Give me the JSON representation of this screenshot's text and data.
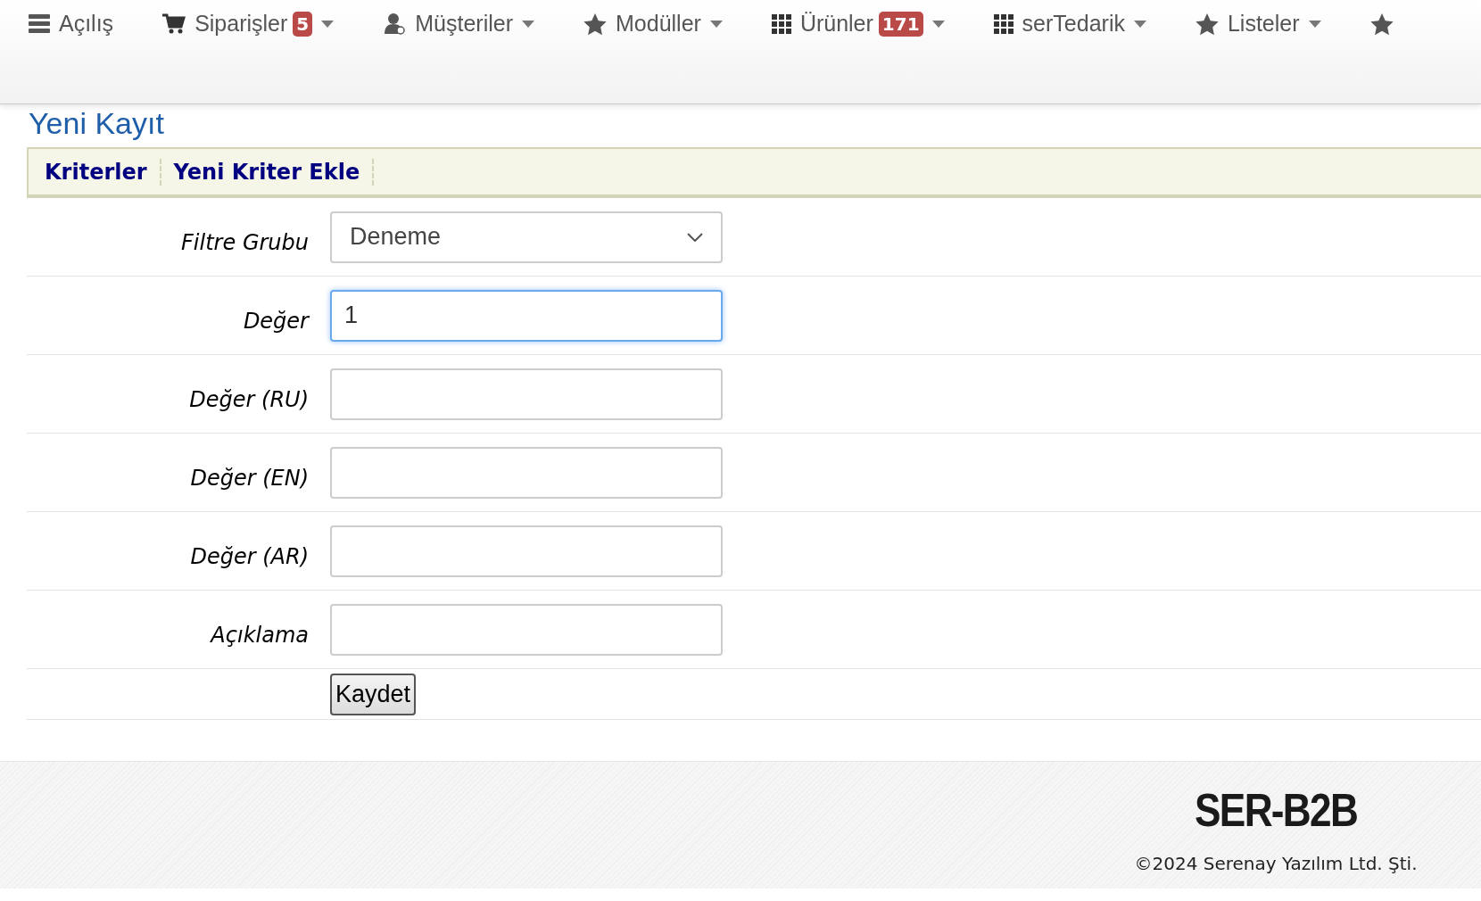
{
  "nav": [
    {
      "kind": "server",
      "label": "Açılış",
      "dropdown": false
    },
    {
      "kind": "cart",
      "label": "Siparişler",
      "badge": "5",
      "dropdown": true
    },
    {
      "kind": "user",
      "label": "Müşteriler",
      "dropdown": true
    },
    {
      "kind": "star",
      "label": "Modüller",
      "dropdown": true
    },
    {
      "kind": "grid",
      "label": "Ürünler",
      "badge": "171",
      "dropdown": true
    },
    {
      "kind": "grid",
      "label": "serTedarik",
      "dropdown": true
    },
    {
      "kind": "star",
      "label": "Listeler",
      "dropdown": true
    },
    {
      "kind": "star",
      "dropdown": false
    }
  ],
  "page_title": "Yeni Kayıt",
  "tabs": [
    {
      "label": "Kriterler"
    },
    {
      "label": "Yeni Kriter Ekle"
    }
  ],
  "form": [
    {
      "kind": "select",
      "label": "Filtre Grubu",
      "value": "Deneme",
      "focused": false
    },
    {
      "kind": "input",
      "label": "Değer",
      "value": "1",
      "focused": true
    },
    {
      "kind": "input",
      "label": "Değer (RU)",
      "focused": false
    },
    {
      "kind": "input",
      "label": "Değer (EN)",
      "focused": false
    },
    {
      "kind": "input",
      "label": "Değer (AR)",
      "focused": false
    },
    {
      "kind": "input",
      "label": "Açıklama",
      "focused": false
    },
    {
      "kind": "button",
      "value": "Kaydet"
    }
  ],
  "footer": {
    "logo": "SER-B2B",
    "copyright": "©2024 Serenay Yazılım Ltd. Şti."
  }
}
